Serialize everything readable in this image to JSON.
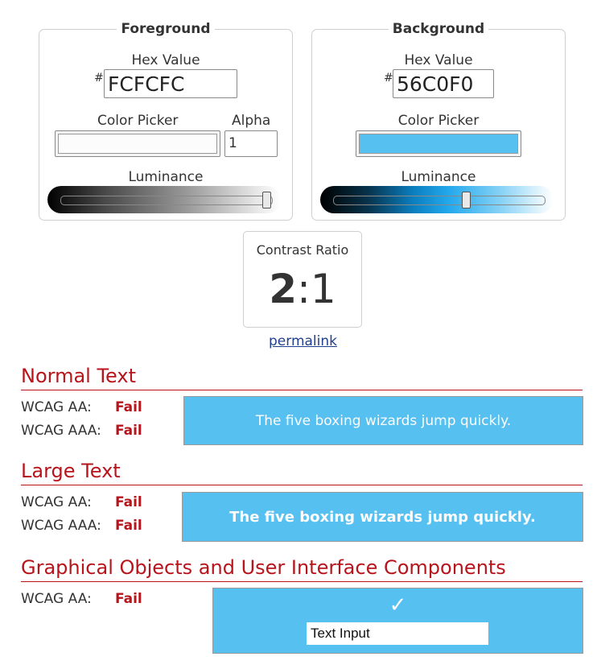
{
  "foreground": {
    "legend": "Foreground",
    "hex_label": "Hex Value",
    "hash": "#",
    "hex_value": "FCFCFC",
    "picker_label": "Color Picker",
    "alpha_label": "Alpha",
    "alpha_value": "1",
    "luminance_label": "Luminance",
    "swatch_color": "#FCFCFC",
    "luminance_level": 0.98
  },
  "background": {
    "legend": "Background",
    "hex_label": "Hex Value",
    "hash": "#",
    "hex_value": "56C0F0",
    "picker_label": "Color Picker",
    "luminance_label": "Luminance",
    "swatch_color": "#56C0F0",
    "luminance_level": 0.63
  },
  "contrast": {
    "label": "Contrast Ratio",
    "ratio_main": "2",
    "ratio_rest": ":1"
  },
  "permalink": "permalink",
  "sections": {
    "normal": {
      "title": "Normal Text",
      "aa_label": "WCAG AA:",
      "aa_result": "Fail",
      "aaa_label": "WCAG AAA:",
      "aaa_result": "Fail",
      "sample": "The five boxing wizards jump quickly."
    },
    "large": {
      "title": "Large Text",
      "aa_label": "WCAG AA:",
      "aa_result": "Fail",
      "aaa_label": "WCAG AAA:",
      "aaa_result": "Fail",
      "sample": "The five boxing wizards jump quickly."
    },
    "graphical": {
      "title": "Graphical Objects and User Interface Components",
      "aa_label": "WCAG AA:",
      "aa_result": "Fail",
      "checkmark": "✓",
      "input_value": "Text Input"
    }
  },
  "colors": {
    "fail": "#b8141b",
    "sample_bg": "#56C0F0",
    "sample_fg": "#FCFCFC"
  }
}
